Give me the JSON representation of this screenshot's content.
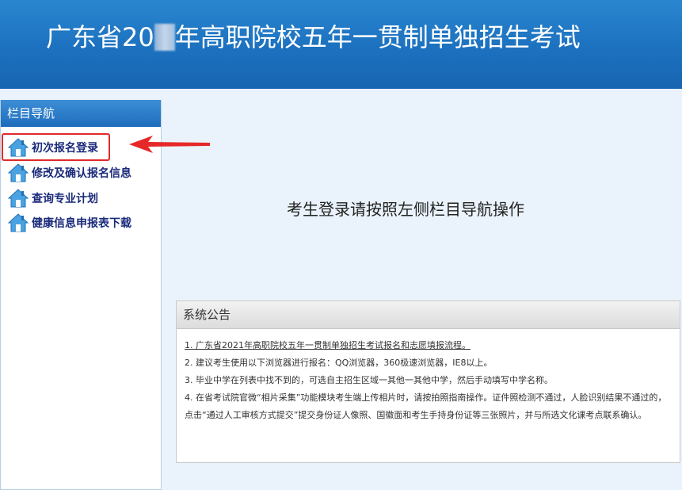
{
  "header": {
    "title_before": "广东省20",
    "title_after": "年高职院校五年一贯制单独招生考试"
  },
  "sidebar": {
    "heading": "栏目导航",
    "items": [
      {
        "label": "初次报名登录",
        "icon": "house-icon"
      },
      {
        "label": "修改及确认报名信息",
        "icon": "house-icon"
      },
      {
        "label": "查询专业计划",
        "icon": "house-icon"
      },
      {
        "label": "健康信息申报表下载",
        "icon": "house-icon"
      }
    ]
  },
  "main": {
    "message": "考生登录请按照左侧栏目导航操作"
  },
  "notice": {
    "heading": "系统公告",
    "items": [
      "1. 广东省2021年高职院校五年一贯制单独招生考试报名和志愿填报流程。",
      "2. 建议考生使用以下浏览器进行报名：QQ浏览器，360极速浏览器，IE8以上。",
      "3. 毕业中学在列表中找不到的，可选自主招生区域一其他一其他中学，然后手动填写中学名称。",
      "4. 在省考试院官微“相片采集”功能模块考生端上传相片时，请按拍照指南操作。证件照检测不通过，人脸识别结果不通过的，点击“通过人工审核方式提交”提交身份证人像照、国徽面和考生手持身份证等三张照片，并与所选文化课考点联系确认。"
    ]
  },
  "colors": {
    "header_blue": "#1c71bf",
    "nav_text": "#1a2a7a",
    "highlight_red": "#e02a2a"
  }
}
